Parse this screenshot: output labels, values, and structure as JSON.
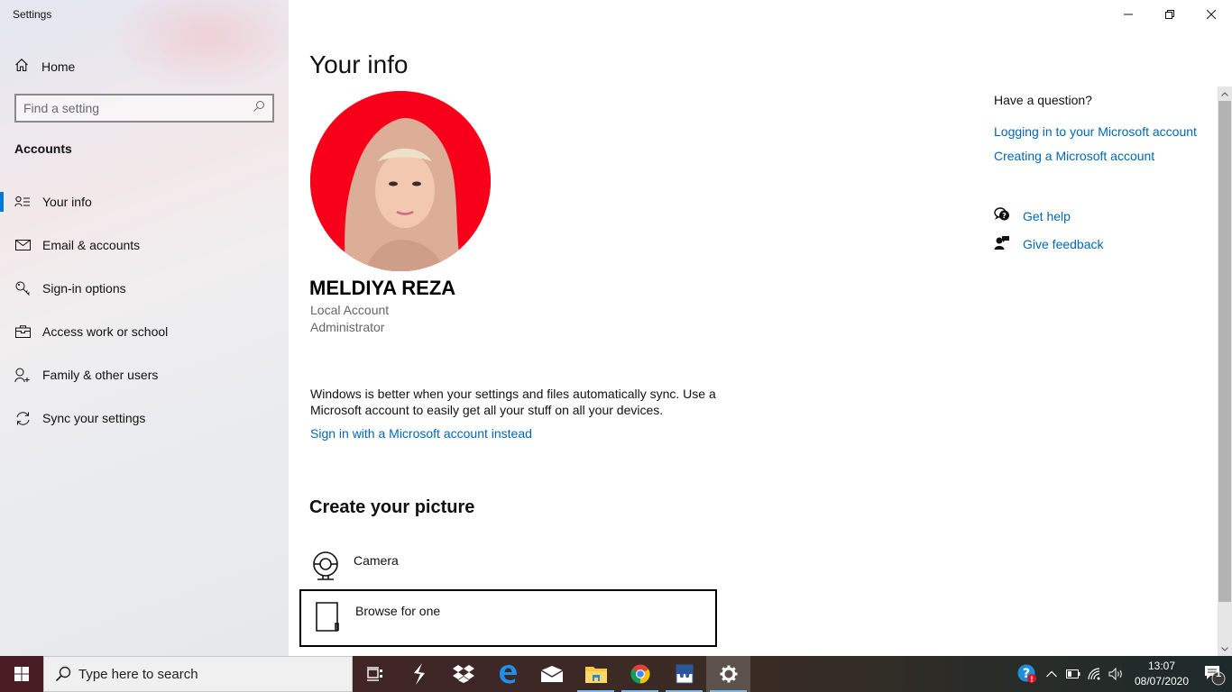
{
  "window": {
    "title": "Settings",
    "controls": {
      "minimize": "minimize",
      "maximize": "restore",
      "close": "close"
    }
  },
  "sidebar": {
    "home_label": "Home",
    "search_placeholder": "Find a setting",
    "section_title": "Accounts",
    "items": [
      {
        "label": "Your info",
        "icon": "person-list-icon",
        "active": true
      },
      {
        "label": "Email & accounts",
        "icon": "mail-icon",
        "active": false
      },
      {
        "label": "Sign-in options",
        "icon": "key-icon",
        "active": false
      },
      {
        "label": "Access work or school",
        "icon": "briefcase-icon",
        "active": false
      },
      {
        "label": "Family & other users",
        "icon": "person-add-icon",
        "active": false
      },
      {
        "label": "Sync your settings",
        "icon": "sync-icon",
        "active": false
      }
    ]
  },
  "main": {
    "title": "Your info",
    "user": {
      "name": "MELDIYA REZA",
      "account_type": "Local Account",
      "role": "Administrator"
    },
    "sync_text": "Windows is better when your settings and files automatically sync. Use a Microsoft account to easily get all your stuff on all your devices.",
    "sign_in_link": "Sign in with a Microsoft account instead",
    "create_picture": {
      "title": "Create your picture",
      "options": [
        {
          "label": "Camera",
          "icon": "camera-icon"
        },
        {
          "label": "Browse for one",
          "icon": "browse-icon"
        }
      ]
    }
  },
  "help": {
    "title": "Have a question?",
    "links": [
      "Logging in to your Microsoft account",
      "Creating a Microsoft account"
    ],
    "get_help": "Get help",
    "give_feedback": "Give feedback"
  },
  "colors": {
    "accent": "#0078d7",
    "link": "#0067b8",
    "avatar_bg": "#f8001a"
  },
  "taskbar": {
    "search_placeholder": "Type here to search",
    "apps": [
      "task-view",
      "app-s",
      "dropbox",
      "edge",
      "mail",
      "file-explorer",
      "chrome",
      "word",
      "settings"
    ],
    "clock": {
      "time": "13:07",
      "date": "08/07/2020"
    },
    "notification_count": "1"
  }
}
